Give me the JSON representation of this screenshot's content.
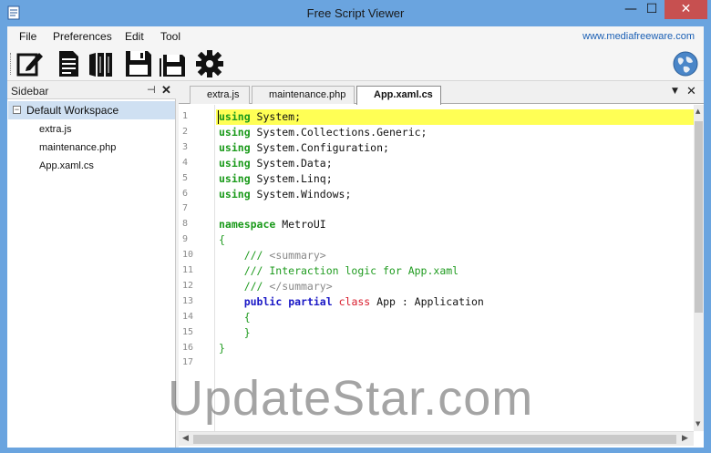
{
  "window": {
    "title": "Free Script Viewer",
    "minimize": "—",
    "maximize": "☐",
    "close": "✕"
  },
  "menu": {
    "items": [
      "File",
      "Preferences",
      "Edit",
      "Tool"
    ],
    "site_link": "www.mediafreeware.com"
  },
  "toolbar": {
    "icons": [
      "edit-icon",
      "document-icon",
      "books-icon",
      "save-icon",
      "save-all-icon",
      "gear-icon",
      "globe-icon"
    ]
  },
  "sidebar": {
    "title": "Sidebar",
    "pin": "⊣",
    "close": "✕",
    "workspace": "Default Workspace",
    "toggle": "−",
    "files": [
      "extra.js",
      "maintenance.php",
      "App.xaml.cs"
    ]
  },
  "tabs": {
    "items": [
      "extra.js",
      "maintenance.php",
      "App.xaml.cs"
    ],
    "active_index": 2,
    "dropdown": "▼",
    "close": "✕"
  },
  "editor": {
    "line_numbers": [
      "1",
      "2",
      "3",
      "4",
      "5",
      "6",
      "7",
      "8",
      "9",
      "10",
      "11",
      "12",
      "13",
      "14",
      "15",
      "16",
      "17"
    ],
    "lines": [
      [
        {
          "t": "using",
          "c": "kw"
        },
        {
          "t": " System;",
          "c": ""
        }
      ],
      [
        {
          "t": "using",
          "c": "kw"
        },
        {
          "t": " System.Collections.Generic;",
          "c": ""
        }
      ],
      [
        {
          "t": "using",
          "c": "kw"
        },
        {
          "t": " System.Configuration;",
          "c": ""
        }
      ],
      [
        {
          "t": "using",
          "c": "kw"
        },
        {
          "t": " System.Data;",
          "c": ""
        }
      ],
      [
        {
          "t": "using",
          "c": "kw"
        },
        {
          "t": " System.Linq;",
          "c": ""
        }
      ],
      [
        {
          "t": "using",
          "c": "kw"
        },
        {
          "t": " System.Windows;",
          "c": ""
        }
      ],
      [],
      [
        {
          "t": "namespace",
          "c": "kw"
        },
        {
          "t": " MetroUI",
          "c": ""
        }
      ],
      [
        {
          "t": "{",
          "c": "cm"
        }
      ],
      [
        {
          "t": "    /// ",
          "c": "cm"
        },
        {
          "t": "<summary>",
          "c": "cmt"
        }
      ],
      [
        {
          "t": "    /// Interaction logic for App.xaml",
          "c": "cm"
        }
      ],
      [
        {
          "t": "    /// ",
          "c": "cm"
        },
        {
          "t": "</summary>",
          "c": "cmt"
        }
      ],
      [
        {
          "t": "    ",
          "c": ""
        },
        {
          "t": "public",
          "c": "kw2"
        },
        {
          "t": " ",
          "c": ""
        },
        {
          "t": "partial",
          "c": "kw2"
        },
        {
          "t": " ",
          "c": ""
        },
        {
          "t": "class",
          "c": "kw3"
        },
        {
          "t": " App : Application",
          "c": ""
        }
      ],
      [
        {
          "t": "    {",
          "c": "cm"
        }
      ],
      [
        {
          "t": "    }",
          "c": "cm"
        }
      ],
      [
        {
          "t": "}",
          "c": "cm"
        }
      ],
      []
    ]
  },
  "watermark": "UpdateStar.com"
}
